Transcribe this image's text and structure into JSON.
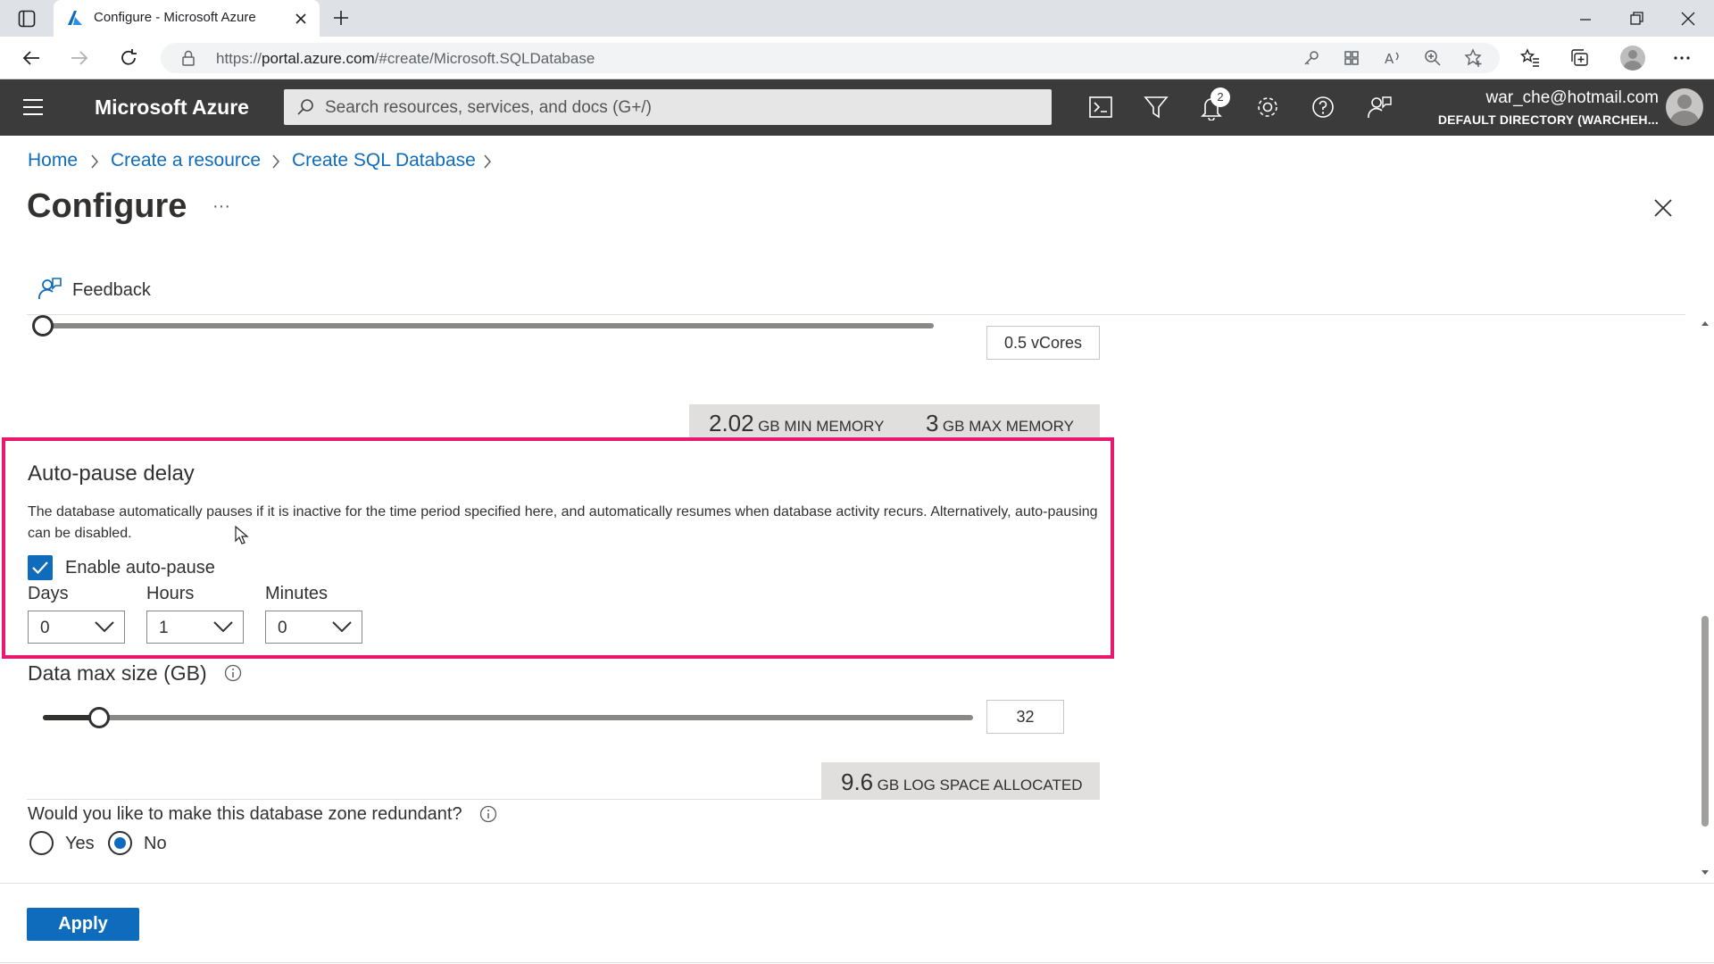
{
  "browser": {
    "tab_title": "Configure - Microsoft Azure",
    "url_prefix": "https://",
    "url_host": "portal.azure.com",
    "url_path": "/#create/Microsoft.SQLDatabase"
  },
  "header": {
    "brand": "Microsoft Azure",
    "search_placeholder": "Search resources, services, and docs (G+/)",
    "notification_count": "2",
    "account_email": "war_che@hotmail.com",
    "account_directory": "DEFAULT DIRECTORY (WARCHEH..."
  },
  "breadcrumb": [
    "Home",
    "Create a resource",
    "Create SQL Database"
  ],
  "page": {
    "title": "Configure",
    "more": "···",
    "feedback": "Feedback"
  },
  "vcores": {
    "value_label": "0.5 vCores",
    "slider_fraction": 0.0
  },
  "memory": {
    "min_value": "2.02",
    "min_label": "GB MIN MEMORY",
    "max_value": "3",
    "max_label": "GB MAX MEMORY"
  },
  "auto_pause": {
    "heading": "Auto-pause delay",
    "description": "The database automatically pauses if it is inactive for the time period specified here, and automatically resumes when database activity recurs. Alternatively, auto-pausing can be disabled.",
    "enable_label": "Enable auto-pause",
    "enabled": true,
    "days_label": "Days",
    "days_value": "0",
    "hours_label": "Hours",
    "hours_value": "1",
    "minutes_label": "Minutes",
    "minutes_value": "0"
  },
  "data_max": {
    "label": "Data max size (GB)",
    "value": "32",
    "slider_fraction": 0.06,
    "log_value": "9.6",
    "log_label": "GB LOG SPACE ALLOCATED"
  },
  "zone": {
    "question": "Would you like to make this database zone redundant?",
    "yes_label": "Yes",
    "no_label": "No",
    "selected": "No"
  },
  "actions": {
    "apply_label": "Apply"
  },
  "colors": {
    "accent": "#0f6cbd",
    "header_bg": "#3b3b3b",
    "highlight": "#e8196f"
  }
}
